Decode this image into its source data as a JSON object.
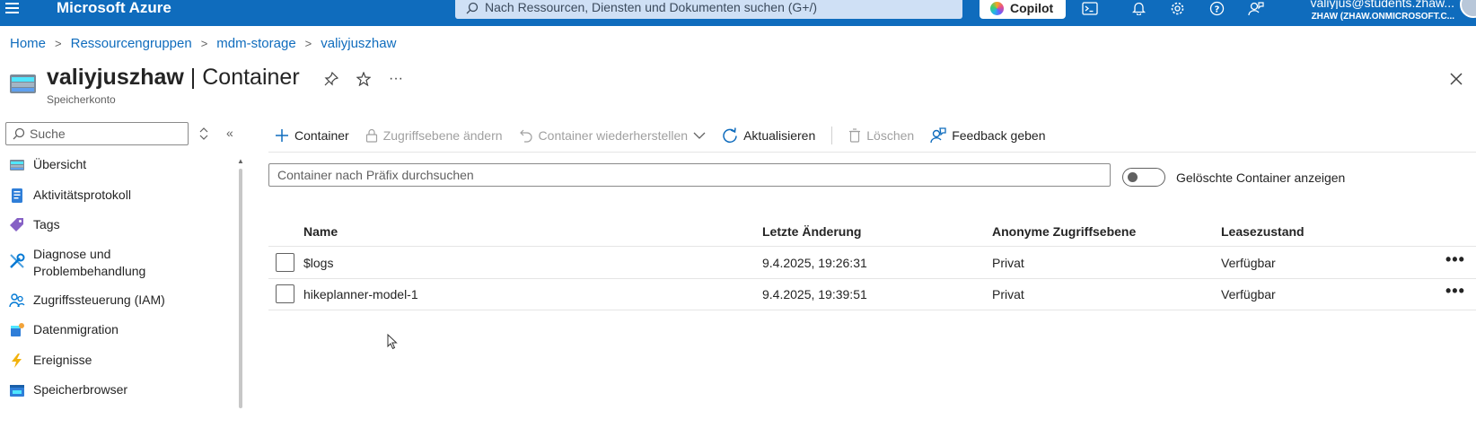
{
  "topbar": {
    "brand": "Microsoft Azure",
    "search_placeholder": "Nach Ressourcen, Diensten und Dokumenten suchen (G+/)",
    "copilot_label": "Copilot",
    "user_email": "valiyjus@students.zhaw...",
    "user_tenant": "ZHAW (ZHAW.ONMICROSOFT.C..."
  },
  "breadcrumb": [
    "Home",
    "Ressourcengruppen",
    "mdm-storage",
    "valiyjuszhaw"
  ],
  "header": {
    "resource_name": "valiyjuszhaw",
    "separator": " | ",
    "page_name": "Container",
    "subtitle": "Speicherkonto",
    "more_label": "···"
  },
  "nav": {
    "search_placeholder": "Suche",
    "collapse_label": "«",
    "items": [
      {
        "label": "Übersicht",
        "icon": "storage-overview-icon"
      },
      {
        "label": "Aktivitätsprotokoll",
        "icon": "activity-log-icon"
      },
      {
        "label": "Tags",
        "icon": "tag-icon"
      },
      {
        "label": "Diagnose und Problembehandlung",
        "icon": "wrench-icon"
      },
      {
        "label": "Zugriffssteuerung (IAM)",
        "icon": "people-icon"
      },
      {
        "label": "Datenmigration",
        "icon": "data-migration-icon"
      },
      {
        "label": "Ereignisse",
        "icon": "lightning-icon"
      },
      {
        "label": "Speicherbrowser",
        "icon": "storage-browser-icon"
      }
    ]
  },
  "commands": {
    "add_container": "Container",
    "change_access": "Zugriffsebene ändern",
    "restore": "Container wiederherstellen",
    "refresh": "Aktualisieren",
    "delete": "Löschen",
    "feedback": "Feedback geben"
  },
  "filter": {
    "prefix_placeholder": "Container nach Präfix durchsuchen",
    "show_deleted_label": "Gelöschte Container anzeigen",
    "show_deleted_on": false
  },
  "table": {
    "columns": [
      "Name",
      "Letzte Änderung",
      "Anonyme Zugriffsebene",
      "Leasezustand"
    ],
    "rows": [
      {
        "name": "$logs",
        "modified": "9.4.2025, 19:26:31",
        "access": "Privat",
        "lease": "Verfügbar",
        "more": "•••"
      },
      {
        "name": "hikeplanner-model-1",
        "modified": "9.4.2025, 19:39:51",
        "access": "Privat",
        "lease": "Verfügbar",
        "more": "•••"
      }
    ]
  },
  "colors": {
    "topbar": "#0f6cbd",
    "link": "#0f6cbd",
    "text": "#242424",
    "muted": "#616161"
  }
}
